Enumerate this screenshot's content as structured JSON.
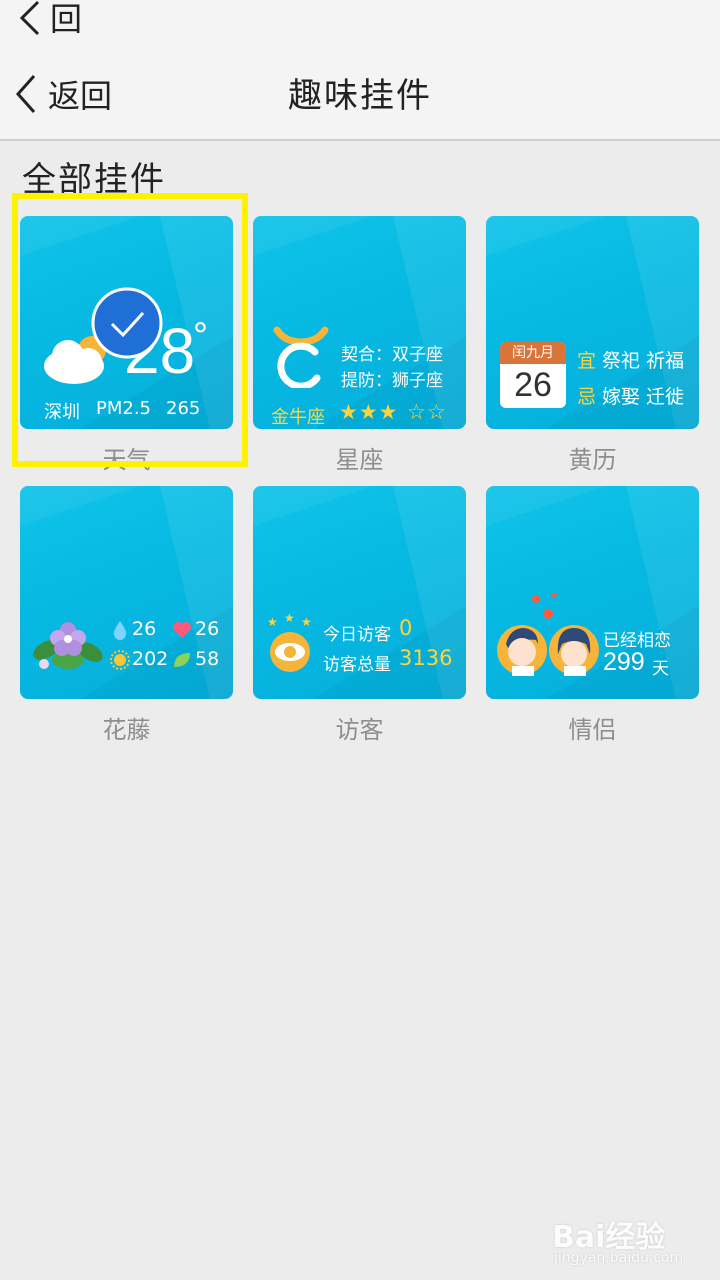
{
  "topbar": {
    "back_label": "回"
  },
  "header": {
    "back_label": "返回",
    "title": "趣味挂件"
  },
  "section": {
    "title": "全部挂件"
  },
  "widgets": {
    "weather": {
      "label": "天气",
      "temp": "28",
      "degree": "°",
      "city": "深圳",
      "pm_label": "PM2.5",
      "pm_value": "265",
      "selected": true
    },
    "star": {
      "label": "星座",
      "match_line": "契合：双子座",
      "guard_line": "提防：狮子座",
      "sign": "金牛座",
      "rating": "3/5",
      "stars_on": "★★★",
      "stars_off": "☆☆"
    },
    "almanac": {
      "label": "黄历",
      "month": "闰九月",
      "day": "26",
      "good_tag": "宜",
      "good_text": "祭祀 祈福",
      "bad_tag": "忌",
      "bad_text": "嫁娶 迁徙"
    },
    "flower": {
      "label": "花藤",
      "water": "26",
      "heart": "26",
      "sun": "202",
      "leaf": "58"
    },
    "visitor": {
      "label": "访客",
      "today_label": "今日访客",
      "today_value": "0",
      "total_label": "访客总量",
      "total_value": "3136"
    },
    "couple": {
      "label": "情侣",
      "text": "已经相恋",
      "days": "299",
      "unit": "天"
    }
  },
  "watermark": {
    "brand": "Bai经验",
    "sub": "jingyan.baidu.com"
  },
  "colors": {
    "card": "#06b9e2",
    "accent_yellow": "#ffd43b",
    "selection": "#fff200",
    "check_blue": "#1f6fd6"
  }
}
